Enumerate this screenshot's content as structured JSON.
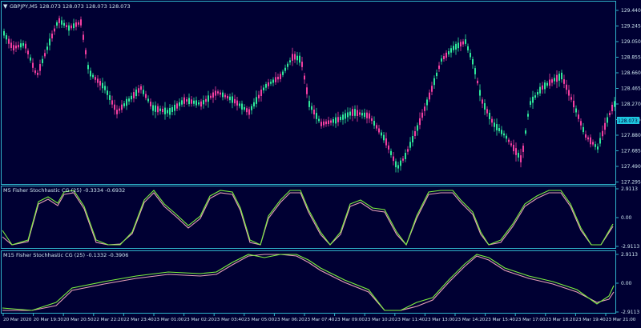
{
  "colors": {
    "background": "#000033",
    "frame": "#2fb2c9",
    "bull_candle": "#2ee89a",
    "bear_candle": "#f23fa0",
    "text": "#cfe6f2",
    "price_tag": "#1ec7e0",
    "fisher_main": "#7cf03f",
    "fisher_signal": "#e8a0b8"
  },
  "main": {
    "header": "GBPJPY,M5  128.073 128.073 128.073 128.073",
    "price_levels": [
      "129.440",
      "129.245",
      "129.050",
      "128.855",
      "128.660",
      "128.465",
      "128.270",
      "128.075",
      "127.880",
      "127.685",
      "127.490",
      "127.295"
    ],
    "current_price": "128.073"
  },
  "indicator1": {
    "label": "M5 Fisher Stochhastic CG (25) -0.3334 -0.6932",
    "levels": [
      "2.9113",
      "0.00",
      "-2.9113"
    ]
  },
  "indicator2": {
    "label": "M15 Fisher Stochhastic CG (25) -0.1332 -0.3906",
    "levels": [
      "2.9113",
      "0.00",
      "-2.9113"
    ]
  },
  "time_axis": [
    "20 Mar 2020",
    "20 Mar 19:30",
    "20 Mar 20:50",
    "22 Mar 22:20",
    "22 Mar 23:40",
    "23 Mar 01:00",
    "23 Mar 02:20",
    "23 Mar 03:40",
    "23 Mar 05:00",
    "23 Mar 06:20",
    "23 Mar 07:40",
    "23 Mar 09:00",
    "23 Mar 10:20",
    "23 Mar 11:40",
    "23 Mar 13:00",
    "23 Mar 14:20",
    "23 Mar 15:40",
    "23 Mar 17:00",
    "23 Mar 18:20",
    "23 Mar 19:40",
    "23 Mar 21:00"
  ]
}
